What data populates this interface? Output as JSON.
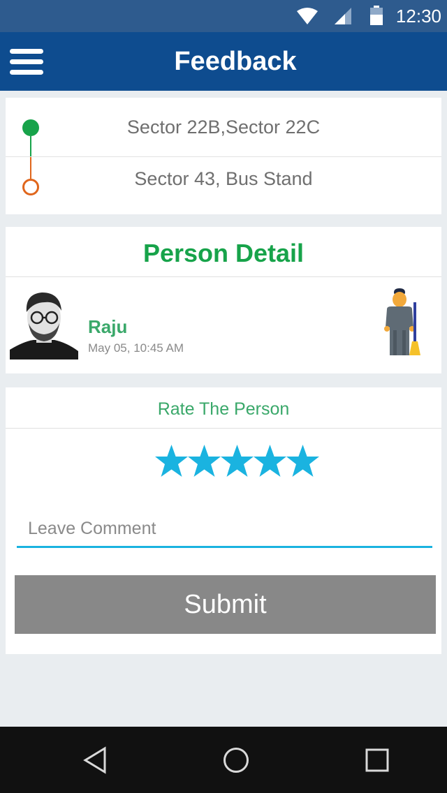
{
  "status_bar": {
    "time": "12:30",
    "icons": [
      "wifi-icon",
      "signal-icon",
      "battery-icon"
    ]
  },
  "app_bar": {
    "title": "Feedback",
    "menu_icon": "hamburger-menu-icon"
  },
  "route": {
    "from": "Sector 22B,Sector 22C",
    "to": "Sector 43, Bus Stand",
    "colors": {
      "start": "#17a34a",
      "end": "#e0661c"
    }
  },
  "person": {
    "heading": "Person Detail",
    "name": "Raju",
    "timestamp": "May 05, 10:45 AM",
    "role_icon": "cleaner-worker-icon"
  },
  "rating": {
    "heading": "Rate The Person",
    "stars_filled": 5,
    "stars_total": 5,
    "star_color": "#1ab3e0",
    "comment_placeholder": "Leave Comment",
    "comment_value": "",
    "submit_label": "Submit"
  },
  "nav_bar": {
    "icons": [
      "back-icon",
      "home-icon",
      "recents-icon"
    ]
  },
  "colors": {
    "app_bar": "#0e4c8f",
    "status_bar": "#2e5b8e",
    "accent_green": "#17a34a",
    "submit_button": "#888888"
  }
}
